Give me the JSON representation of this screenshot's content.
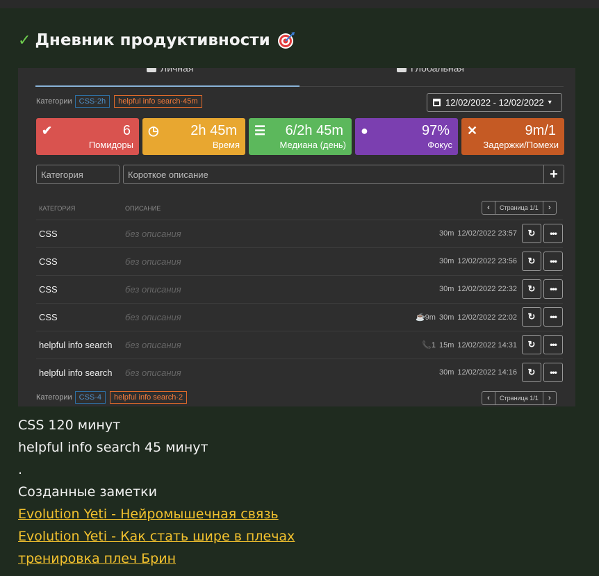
{
  "page": {
    "heading": "Дневник продуктивности",
    "heading_icon": "target-emoji-icon",
    "check_icon": "checkmark-icon"
  },
  "app": {
    "tabs": {
      "personal": "Личная",
      "global": "Глобальная"
    },
    "categories_label": "Категории",
    "top_chips": [
      {
        "text": "CSS·2h",
        "color": "#4f8fc7"
      },
      {
        "text": "helpful info search·45m",
        "color": "#f07a3a"
      }
    ],
    "date_range": "12/02/2022 - 12/02/2022",
    "stats": [
      {
        "icon": "check-circle-icon",
        "value": "6",
        "label": "Помидоры",
        "color": "#d9534f"
      },
      {
        "icon": "clock-icon",
        "value": "2h 45m",
        "label": "Время",
        "color": "#e8a730"
      },
      {
        "icon": "list-icon",
        "value": "6/2h 45m",
        "label": "Медиана (день)",
        "color": "#5cb85c"
      },
      {
        "icon": "lightbulb-icon",
        "value": "97%",
        "label": "Фокус",
        "color": "#7b3fb0"
      },
      {
        "icon": "x-icon",
        "value": "9m/1",
        "label": "Задержки/Помехи",
        "color": "#c55a24"
      }
    ],
    "inputs": {
      "category_placeholder": "Категория",
      "description_placeholder": "Короткое описание",
      "add_label": "+"
    },
    "table": {
      "col_category": "Категория",
      "col_description": "Описание",
      "page_label": "Страница 1/1",
      "rows": [
        {
          "category": "CSS",
          "description": "без описания",
          "extra": "",
          "duration": "30m",
          "datetime": "12/02/2022 23:57"
        },
        {
          "category": "CSS",
          "description": "без описания",
          "extra": "",
          "duration": "30m",
          "datetime": "12/02/2022 23:56"
        },
        {
          "category": "CSS",
          "description": "без описания",
          "extra": "",
          "duration": "30m",
          "datetime": "12/02/2022 22:32"
        },
        {
          "category": "CSS",
          "description": "без описания",
          "extra": "☕9m",
          "duration": "30m",
          "datetime": "12/02/2022 22:02"
        },
        {
          "category": "helpful info search",
          "description": "без описания",
          "extra": "📞1",
          "duration": "15m",
          "datetime": "12/02/2022 14:31"
        },
        {
          "category": "helpful info search",
          "description": "без описания",
          "extra": "",
          "duration": "30m",
          "datetime": "12/02/2022 14:16"
        }
      ]
    },
    "bottom_chips": [
      {
        "text": "CSS·4",
        "color": "#4f8fc7"
      },
      {
        "text": "helpful info search·2",
        "color": "#f07a3a"
      }
    ]
  },
  "notes": {
    "line1": "CSS 120 минут",
    "line2": "helpful info search 45 минут",
    "line3": ".",
    "created_heading": "Созданные заметки",
    "links": [
      "Evolution Yeti - Нейромышечная связь",
      "Evolution Yeti - Как стать шире в плечах",
      "тренировка плеч Брин"
    ]
  }
}
